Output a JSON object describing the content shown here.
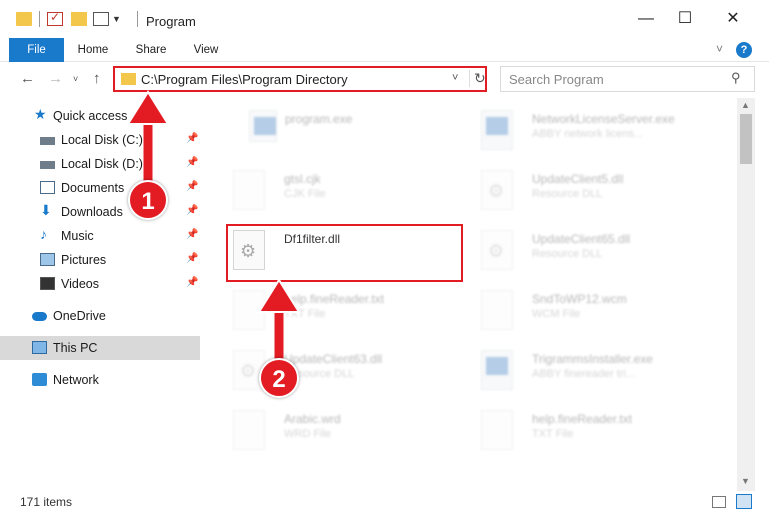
{
  "window": {
    "title": "Program",
    "minimize": "—",
    "maximize": "☐",
    "close": "✕"
  },
  "ribbon": {
    "tabs": [
      "File",
      "Home",
      "Share",
      "View"
    ],
    "help": "?"
  },
  "nav": {
    "back": "←",
    "forward": "→",
    "up": "↑",
    "address": "C:\\Program Files\\Program Directory",
    "search_placeholder": "Search Program"
  },
  "sidebar": {
    "items": [
      {
        "label": "Quick access",
        "icon": "star-icon"
      },
      {
        "label": "Local Disk (C:)",
        "icon": "drive-icon",
        "pinned": true
      },
      {
        "label": "Local Disk (D:)",
        "icon": "drive-icon",
        "pinned": true
      },
      {
        "label": "Documents",
        "icon": "documents-icon",
        "pinned": true
      },
      {
        "label": "Downloads",
        "icon": "download-icon",
        "pinned": true
      },
      {
        "label": "Music",
        "icon": "music-icon",
        "pinned": true
      },
      {
        "label": "Pictures",
        "icon": "pictures-icon",
        "pinned": true
      },
      {
        "label": "Videos",
        "icon": "videos-icon",
        "pinned": true
      },
      {
        "label": "OneDrive",
        "icon": "onedrive-icon"
      },
      {
        "label": "This PC",
        "icon": "pc-icon",
        "selected": true
      },
      {
        "label": "Network",
        "icon": "network-icon"
      }
    ]
  },
  "files": {
    "left": [
      {
        "name": "program.exe",
        "type": ""
      },
      {
        "name": "gtsl.cjk",
        "type": "CJK File"
      },
      {
        "name": "Df1filter.dll",
        "type": ""
      },
      {
        "name": "help.fineReader.txt",
        "type": "TXT File"
      },
      {
        "name": "UpdateClient63.dll",
        "type": "Resource DLL"
      },
      {
        "name": "Arabic.wrd",
        "type": "WRD File"
      }
    ],
    "right": [
      {
        "name": "NetworkLicenseServer.exe",
        "type": "ABBY network licens..."
      },
      {
        "name": "UpdateClient5.dll",
        "type": "Resource DLL"
      },
      {
        "name": "UpdateClient65.dll",
        "type": "Resource DLL"
      },
      {
        "name": "SndToWP12.wcm",
        "type": "WCM File"
      },
      {
        "name": "TrigrammsInstaller.exe",
        "type": "ABBY finereader tri..."
      },
      {
        "name": "help.fineReader.txt",
        "type": "TXT File"
      }
    ]
  },
  "status": {
    "item_count": "171 items"
  },
  "annotations": {
    "step1": "1",
    "step2": "2",
    "color": "#e31b23"
  }
}
